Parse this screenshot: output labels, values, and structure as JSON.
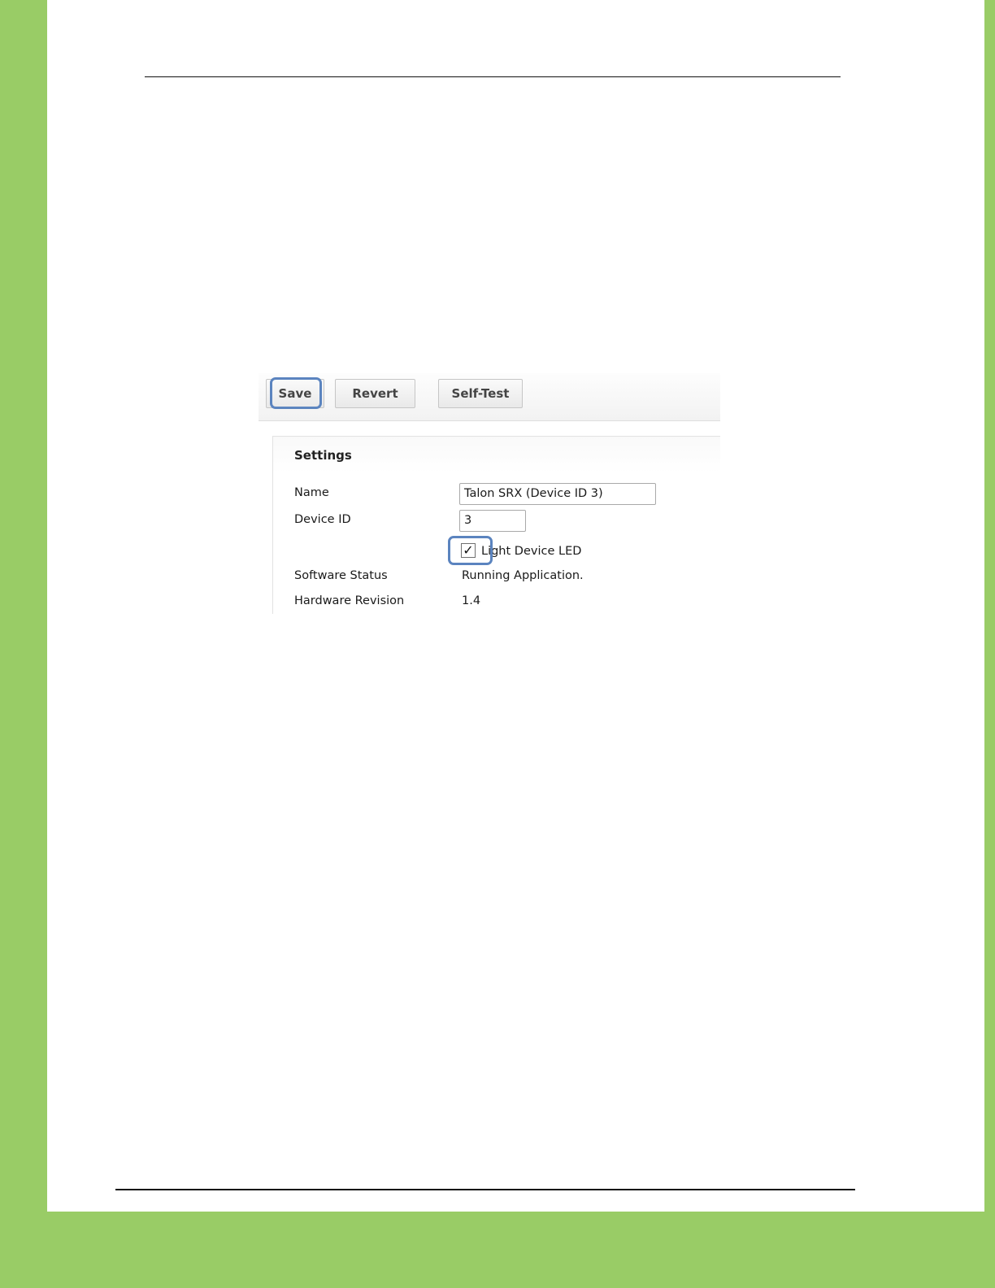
{
  "toolbar": {
    "save_label": "Save",
    "revert_label": "Revert",
    "selftest_label": "Self-Test"
  },
  "settings": {
    "title": "Settings",
    "fields": {
      "name_label": "Name",
      "name_value": "Talon SRX (Device ID 3)",
      "device_id_label": "Device ID",
      "device_id_value": "3",
      "led_label": "Light Device LED",
      "led_checked": true,
      "check_glyph": "✓",
      "software_status_label": "Software Status",
      "software_status_value": "Running Application.",
      "hardware_revision_label": "Hardware Revision",
      "hardware_revision_value": "1.4"
    }
  },
  "colors": {
    "frame_green": "#99cc66",
    "highlight_blue": "#5b84bf"
  }
}
